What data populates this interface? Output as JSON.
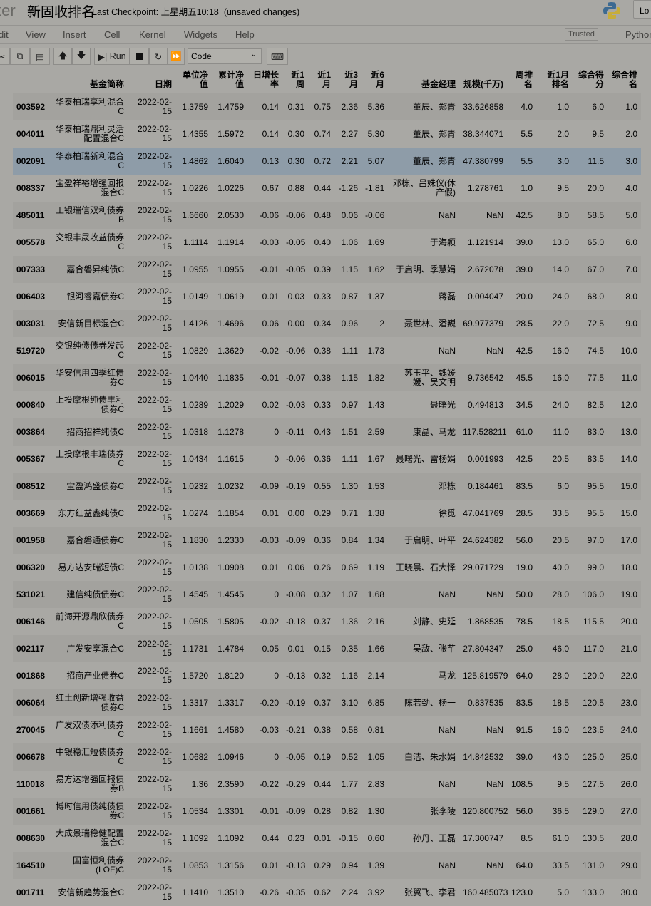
{
  "header": {
    "logo_text": "ter",
    "title": "新固收排名",
    "checkpoint_label": "Last Checkpoint:",
    "checkpoint_time": "上星期五10:18",
    "unsaved": "(unsaved changes)",
    "login_label": "Lo"
  },
  "menu": {
    "items": [
      "dit",
      "View",
      "Insert",
      "Cell",
      "Kernel",
      "Widgets",
      "Help"
    ],
    "trusted": "Trusted",
    "kernel": "Python"
  },
  "toolbar": {
    "run_label": "Run",
    "cell_type": "Code"
  },
  "colors": {
    "highlight_row": "#8e9ca8"
  },
  "table": {
    "columns": [
      "",
      "基金简称",
      "日期",
      "单位净值",
      "累计净值",
      "日增长率",
      "近1周",
      "近1月",
      "近3月",
      "近6月",
      "基金经理",
      "规模(千万)",
      "周排名",
      "近1月排名",
      "综合得分",
      "综合排名"
    ],
    "highlighted_row": 2,
    "rows": [
      [
        "003592",
        "华泰柏瑞享利混合C",
        "2022-02-15",
        "1.3759",
        "1.4759",
        "0.14",
        "0.31",
        "0.75",
        "2.36",
        "5.36",
        "董辰、郑青",
        "33.626858",
        "4.0",
        "1.0",
        "6.0",
        "1.0"
      ],
      [
        "004011",
        "华泰柏瑞鼎利灵活配置混合C",
        "2022-02-15",
        "1.4355",
        "1.5972",
        "0.14",
        "0.30",
        "0.74",
        "2.27",
        "5.30",
        "董辰、郑青",
        "38.344071",
        "5.5",
        "2.0",
        "9.5",
        "2.0"
      ],
      [
        "002091",
        "华泰柏瑞新利混合C",
        "2022-02-15",
        "1.4862",
        "1.6040",
        "0.13",
        "0.30",
        "0.72",
        "2.21",
        "5.07",
        "董辰、郑青",
        "47.380799",
        "5.5",
        "3.0",
        "11.5",
        "3.0"
      ],
      [
        "008337",
        "宝盈祥裕增强回报混合C",
        "2022-02-15",
        "1.0226",
        "1.0226",
        "0.67",
        "0.88",
        "0.44",
        "-1.26",
        "-1.81",
        "邓栋、吕姝仪(休产假)",
        "1.278761",
        "1.0",
        "9.5",
        "20.0",
        "4.0"
      ],
      [
        "485011",
        "工银瑞信双利债券B",
        "2022-02-15",
        "1.6660",
        "2.0530",
        "-0.06",
        "-0.06",
        "0.48",
        "0.06",
        "-0.06",
        "NaN",
        "NaN",
        "42.5",
        "8.0",
        "58.5",
        "5.0"
      ],
      [
        "005578",
        "交银丰晟收益债券C",
        "2022-02-15",
        "1.1114",
        "1.1914",
        "-0.03",
        "-0.05",
        "0.40",
        "1.06",
        "1.69",
        "于海颖",
        "1.121914",
        "39.0",
        "13.0",
        "65.0",
        "6.0"
      ],
      [
        "007333",
        "嘉合磐昇纯债C",
        "2022-02-15",
        "1.0955",
        "1.0955",
        "-0.01",
        "-0.05",
        "0.39",
        "1.15",
        "1.62",
        "于启明、季慧娟",
        "2.672078",
        "39.0",
        "14.0",
        "67.0",
        "7.0"
      ],
      [
        "006403",
        "银河睿嘉债券C",
        "2022-02-15",
        "1.0149",
        "1.0619",
        "0.01",
        "0.03",
        "0.33",
        "0.87",
        "1.37",
        "蒋磊",
        "0.004047",
        "20.0",
        "24.0",
        "68.0",
        "8.0"
      ],
      [
        "003031",
        "安信新目标混合C",
        "2022-02-15",
        "1.4126",
        "1.4696",
        "0.06",
        "0.00",
        "0.34",
        "0.96",
        "2",
        "聂世林、潘巍",
        "69.977379",
        "28.5",
        "22.0",
        "72.5",
        "9.0"
      ],
      [
        "519720",
        "交银纯债债券发起C",
        "2022-02-15",
        "1.0829",
        "1.3629",
        "-0.02",
        "-0.06",
        "0.38",
        "1.11",
        "1.73",
        "NaN",
        "NaN",
        "42.5",
        "16.0",
        "74.5",
        "10.0"
      ],
      [
        "006015",
        "华安信用四季红债券C",
        "2022-02-15",
        "1.0440",
        "1.1835",
        "-0.01",
        "-0.07",
        "0.38",
        "1.15",
        "1.82",
        "苏玉平、魏媛媛、吴文明",
        "9.736542",
        "45.5",
        "16.0",
        "77.5",
        "11.0"
      ],
      [
        "000840",
        "上投摩根纯债丰利债券C",
        "2022-02-15",
        "1.0289",
        "1.2029",
        "0.02",
        "-0.03",
        "0.33",
        "0.97",
        "1.43",
        "聂曙光",
        "0.494813",
        "34.5",
        "24.0",
        "82.5",
        "12.0"
      ],
      [
        "003864",
        "招商招祥纯债C",
        "2022-02-15",
        "1.0318",
        "1.1278",
        "0",
        "-0.11",
        "0.43",
        "1.51",
        "2.59",
        "康晶、马龙",
        "117.528211",
        "61.0",
        "11.0",
        "83.0",
        "13.0"
      ],
      [
        "005367",
        "上投摩根丰瑞债券C",
        "2022-02-15",
        "1.0434",
        "1.1615",
        "0",
        "-0.06",
        "0.36",
        "1.11",
        "1.67",
        "聂曙光、雷杨娟",
        "0.001993",
        "42.5",
        "20.5",
        "83.5",
        "14.0"
      ],
      [
        "008512",
        "宝盈鸿盛债券C",
        "2022-02-15",
        "1.0232",
        "1.0232",
        "-0.09",
        "-0.19",
        "0.55",
        "1.30",
        "1.53",
        "邓栋",
        "0.184461",
        "83.5",
        "6.0",
        "95.5",
        "15.0"
      ],
      [
        "003669",
        "东方红益鑫纯债C",
        "2022-02-15",
        "1.0274",
        "1.1854",
        "0.01",
        "0.00",
        "0.29",
        "0.71",
        "1.38",
        "徐觅",
        "47.041769",
        "28.5",
        "33.5",
        "95.5",
        "15.0"
      ],
      [
        "001958",
        "嘉合磐通债券C",
        "2022-02-15",
        "1.1830",
        "1.2330",
        "-0.03",
        "-0.09",
        "0.36",
        "0.84",
        "1.34",
        "于启明、叶平",
        "24.624382",
        "56.0",
        "20.5",
        "97.0",
        "17.0"
      ],
      [
        "006320",
        "易方达安瑞短债C",
        "2022-02-15",
        "1.0138",
        "1.0908",
        "0.01",
        "0.06",
        "0.26",
        "0.69",
        "1.19",
        "王晓晨、石大怿",
        "29.071729",
        "19.0",
        "40.0",
        "99.0",
        "18.0"
      ],
      [
        "531021",
        "建信纯债债券C",
        "2022-02-15",
        "1.4545",
        "1.4545",
        "0",
        "-0.08",
        "0.32",
        "1.07",
        "1.68",
        "NaN",
        "NaN",
        "50.0",
        "28.0",
        "106.0",
        "19.0"
      ],
      [
        "006146",
        "前海开源鼎欣债券C",
        "2022-02-15",
        "1.0505",
        "1.5805",
        "-0.02",
        "-0.18",
        "0.37",
        "1.36",
        "2.16",
        "刘静、史延",
        "1.868535",
        "78.5",
        "18.5",
        "115.5",
        "20.0"
      ],
      [
        "002117",
        "广发安享混合C",
        "2022-02-15",
        "1.1731",
        "1.4784",
        "0.05",
        "0.01",
        "0.15",
        "0.35",
        "1.66",
        "吴敌、张芊",
        "27.804347",
        "25.0",
        "46.0",
        "117.0",
        "21.0"
      ],
      [
        "001868",
        "招商产业债券C",
        "2022-02-15",
        "1.5720",
        "1.8120",
        "0",
        "-0.13",
        "0.32",
        "1.16",
        "2.14",
        "马龙",
        "125.819579",
        "64.0",
        "28.0",
        "120.0",
        "22.0"
      ],
      [
        "006064",
        "红土创新增强收益债券C",
        "2022-02-15",
        "1.3317",
        "1.3317",
        "-0.20",
        "-0.19",
        "0.37",
        "3.10",
        "6.85",
        "陈若劲、杨一",
        "0.837535",
        "83.5",
        "18.5",
        "120.5",
        "23.0"
      ],
      [
        "270045",
        "广发双债添利债券C",
        "2022-02-15",
        "1.1661",
        "1.4580",
        "-0.03",
        "-0.21",
        "0.38",
        "0.58",
        "0.81",
        "NaN",
        "NaN",
        "91.5",
        "16.0",
        "123.5",
        "24.0"
      ],
      [
        "006678",
        "中银稳汇短债债券C",
        "2022-02-15",
        "1.0682",
        "1.0946",
        "0",
        "-0.05",
        "0.19",
        "0.52",
        "1.05",
        "白洁、朱水娟",
        "14.842532",
        "39.0",
        "43.0",
        "125.0",
        "25.0"
      ],
      [
        "110018",
        "易方达增强回报债券B",
        "2022-02-15",
        "1.36",
        "2.3590",
        "-0.22",
        "-0.29",
        "0.44",
        "1.77",
        "2.83",
        "NaN",
        "NaN",
        "108.5",
        "9.5",
        "127.5",
        "26.0"
      ],
      [
        "001661",
        "博时信用债纯债债券C",
        "2022-02-15",
        "1.0534",
        "1.3301",
        "-0.01",
        "-0.09",
        "0.28",
        "0.82",
        "1.30",
        "张李陵",
        "120.800752",
        "56.0",
        "36.5",
        "129.0",
        "27.0"
      ],
      [
        "008630",
        "大成景瑞稳健配置混合C",
        "2022-02-15",
        "1.1092",
        "1.1092",
        "0.44",
        "0.23",
        "0.01",
        "-0.15",
        "0.60",
        "孙丹、王磊",
        "17.300747",
        "8.5",
        "61.0",
        "130.5",
        "28.0"
      ],
      [
        "164510",
        "国富恒利债券(LOF)C",
        "2022-02-15",
        "1.0853",
        "1.3156",
        "0.01",
        "-0.13",
        "0.29",
        "0.94",
        "1.39",
        "NaN",
        "NaN",
        "64.0",
        "33.5",
        "131.0",
        "29.0"
      ],
      [
        "001711",
        "安信新趋势混合C",
        "2022-02-15",
        "1.1410",
        "1.3510",
        "-0.26",
        "-0.35",
        "0.62",
        "2.24",
        "3.92",
        "张翼飞、李君",
        "160.485073",
        "123.0",
        "5.0",
        "133.0",
        "30.0"
      ]
    ]
  }
}
